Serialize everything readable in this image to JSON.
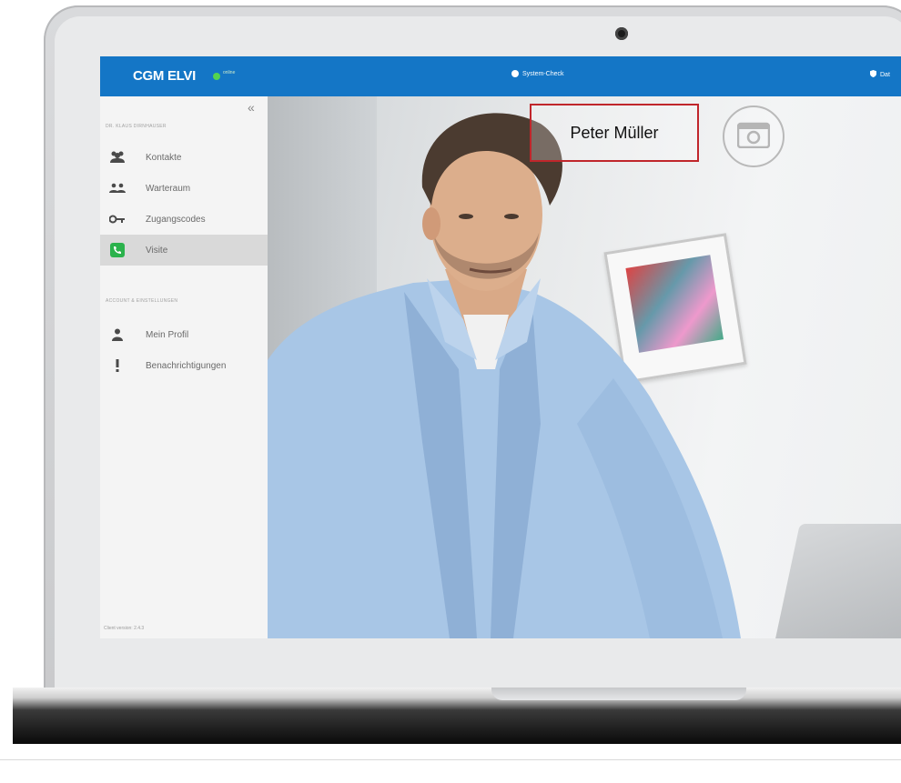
{
  "app": {
    "brand": "CGM ELVI",
    "status": "online",
    "system_check": "System-Check",
    "header_right": "Dat"
  },
  "sidebar": {
    "user_heading": "DR. KLAUS DIRNHAUSER",
    "items": [
      {
        "label": "Kontakte",
        "icon": "contacts-icon"
      },
      {
        "label": "Warteraum",
        "icon": "waiting-room-icon"
      },
      {
        "label": "Zugangscodes",
        "icon": "key-icon"
      },
      {
        "label": "Visite",
        "icon": "phone-icon",
        "active": true
      }
    ],
    "settings_heading": "ACCOUNT & EINSTELLUNGEN",
    "settings_items": [
      {
        "label": "Mein Profil",
        "icon": "user-icon"
      },
      {
        "label": "Benachrichtigungen",
        "icon": "exclamation-icon"
      }
    ],
    "version": "Client version: 2.4.3"
  },
  "call": {
    "participant_name": "Peter Müller"
  },
  "colors": {
    "topbar": "#1476c6",
    "status_online": "#53d34f",
    "highlight_border": "#c0262b",
    "active_item": "#d9d9d9"
  }
}
